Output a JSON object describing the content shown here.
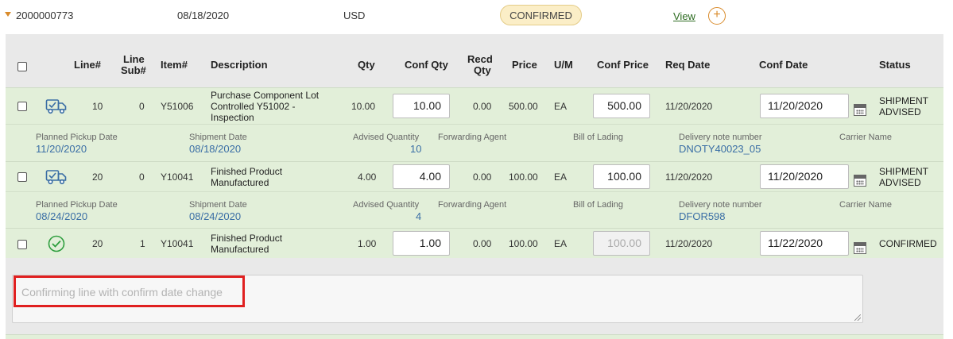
{
  "order": {
    "number": "2000000773",
    "date": "08/18/2020",
    "currency": "USD",
    "status": "CONFIRMED",
    "view_label": "View",
    "add_label": "+"
  },
  "columns": {
    "line": "Line#",
    "line_sub_1": "Line",
    "line_sub_2": "Sub#",
    "item": "Item#",
    "description": "Description",
    "qty": "Qty",
    "conf_qty": "Conf Qty",
    "recd_qty_1": "Recd",
    "recd_qty_2": "Qty",
    "price": "Price",
    "um": "U/M",
    "conf_price": "Conf Price",
    "req_date": "Req Date",
    "conf_date": "Conf Date",
    "status": "Status"
  },
  "lines": [
    {
      "icon": "truck-check-icon",
      "line": "10",
      "sub": "0",
      "item": "Y51006",
      "description": "Purchase Component Lot Controlled Y51002 - Inspection",
      "qty": "10.00",
      "conf_qty": "10.00",
      "recd_qty": "0.00",
      "price": "500.00",
      "um": "EA",
      "conf_price": "500.00",
      "req_date": "11/20/2020",
      "conf_date": "11/20/2020",
      "status_1": "SHIPMENT",
      "status_2": "ADVISED",
      "detail": {
        "pickup_label": "Planned Pickup Date",
        "pickup": "11/20/2020",
        "ship_label": "Shipment Date",
        "ship": "08/18/2020",
        "adv_label": "Advised Quantity",
        "adv": "10",
        "fwd_label": "Forwarding Agent",
        "bol_label": "Bill of Lading",
        "dn_label": "Delivery note number",
        "dn": "DNOTY40023_05",
        "carrier_label": "Carrier Name"
      }
    },
    {
      "icon": "truck-check-icon",
      "line": "20",
      "sub": "0",
      "item": "Y10041",
      "description": "Finished Product Manufactured",
      "qty": "4.00",
      "conf_qty": "4.00",
      "recd_qty": "0.00",
      "price": "100.00",
      "um": "EA",
      "conf_price": "100.00",
      "req_date": "11/20/2020",
      "conf_date": "11/20/2020",
      "status_1": "SHIPMENT",
      "status_2": "ADVISED",
      "detail": {
        "pickup_label": "Planned Pickup Date",
        "pickup": "08/24/2020",
        "ship_label": "Shipment Date",
        "ship": "08/24/2020",
        "adv_label": "Advised Quantity",
        "adv": "4",
        "fwd_label": "Forwarding Agent",
        "bol_label": "Bill of Lading",
        "dn_label": "Delivery note number",
        "dn": "DFOR598",
        "carrier_label": "Carrier Name"
      }
    },
    {
      "icon": "check-circle-icon",
      "line": "20",
      "sub": "1",
      "item": "Y10041",
      "description": "Finished Product Manufactured",
      "qty": "1.00",
      "conf_qty": "1.00",
      "recd_qty": "0.00",
      "price": "100.00",
      "um": "EA",
      "conf_price": "100.00",
      "req_date": "11/20/2020",
      "conf_date": "11/22/2020",
      "status_1": "CONFIRMED"
    }
  ],
  "comment": {
    "placeholder": "Confirming line with confirm date change"
  },
  "colors": {
    "accent": "#d98b2b",
    "row_green": "#e2efd9",
    "link_blue": "#3a6ea5",
    "highlight_red": "#e02020"
  }
}
